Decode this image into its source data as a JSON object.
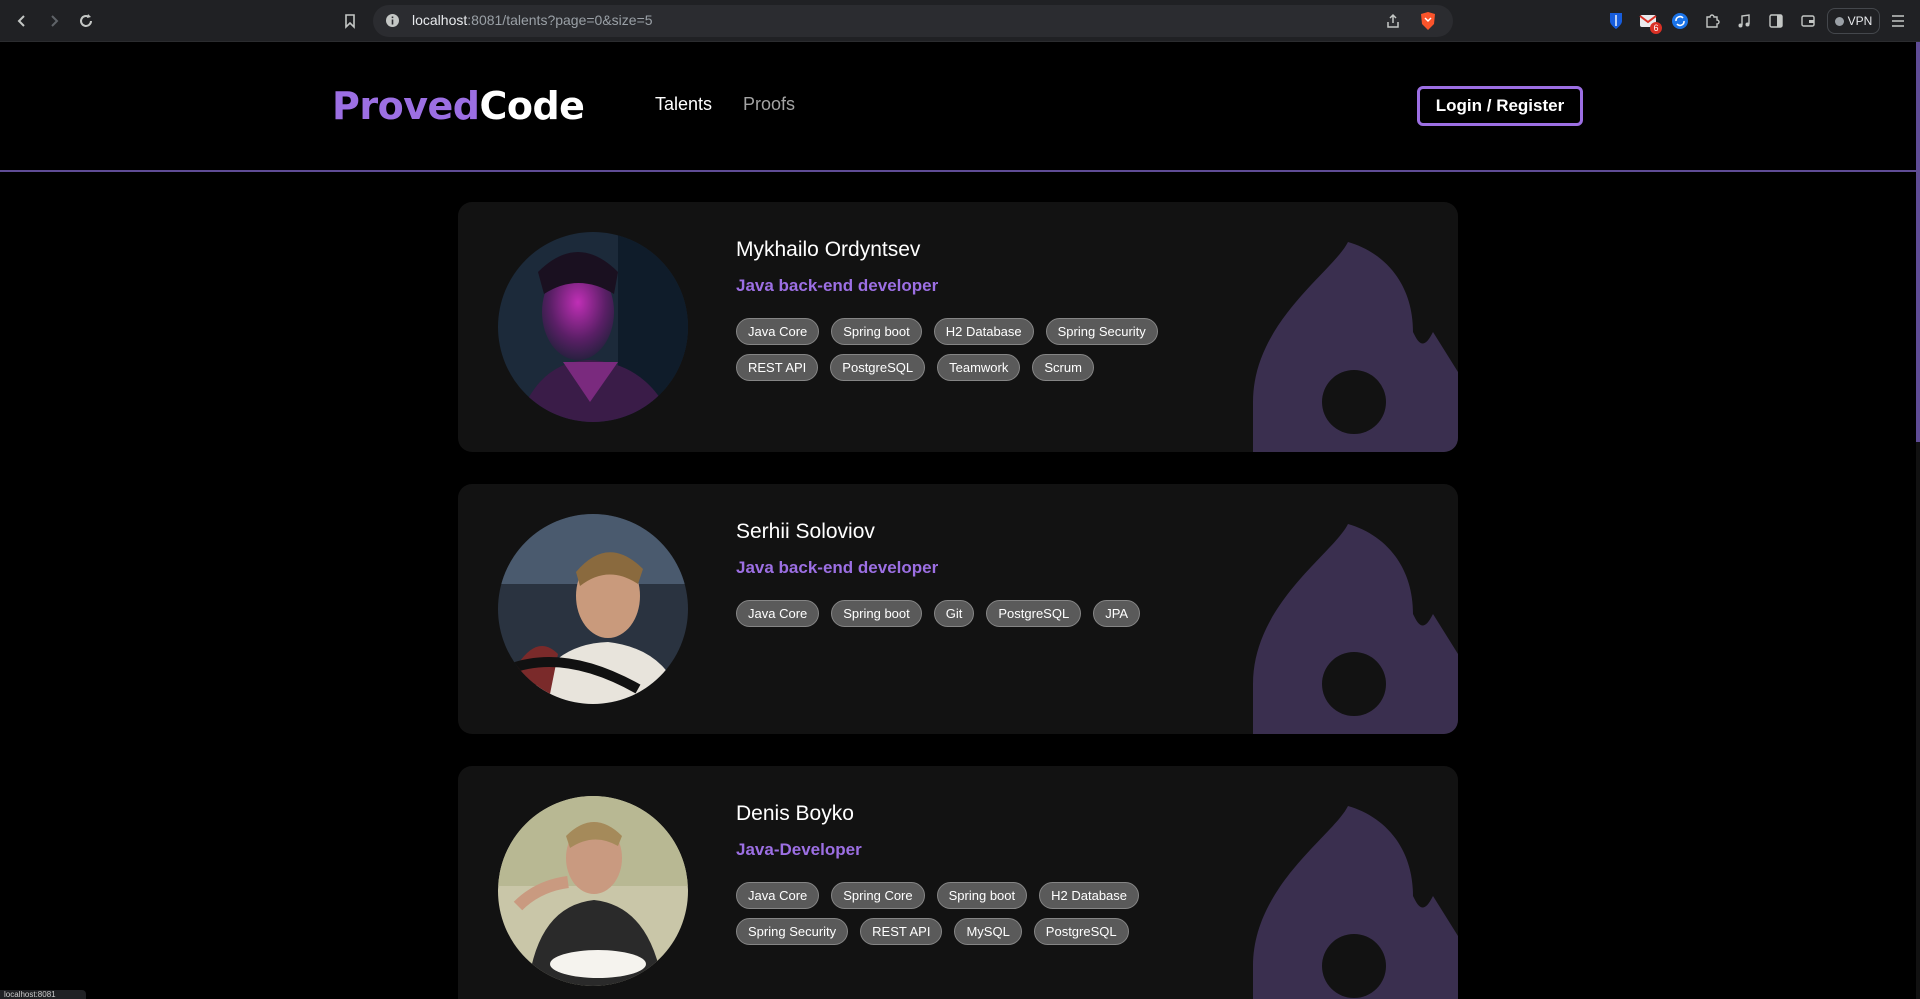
{
  "browser": {
    "url_host": "localhost",
    "url_rest": ":8081/talents?page=0&size=5",
    "extensions_badge": "6",
    "vpn_label": "VPN"
  },
  "site": {
    "logo_part1": "Proved",
    "logo_part2": "Code",
    "nav": [
      {
        "label": "Talents"
      },
      {
        "label": "Proofs"
      }
    ],
    "login_label": "Login / Register"
  },
  "talents": [
    {
      "name": "Mykhailo Ordyntsev",
      "role": "Java back-end developer",
      "skills": [
        "Java Core",
        "Spring boot",
        "H2 Database",
        "Spring Security",
        "REST API",
        "PostgreSQL",
        "Teamwork",
        "Scrum"
      ]
    },
    {
      "name": "Serhii Soloviov",
      "role": "Java back-end developer",
      "skills": [
        "Java Core",
        "Spring boot",
        "Git",
        "PostgreSQL",
        "JPA"
      ]
    },
    {
      "name": "Denis Boyko",
      "role": "Java-Developer",
      "skills": [
        "Java Core",
        "Spring Core",
        "Spring boot",
        "H2 Database",
        "Spring Security",
        "REST API",
        "MySQL",
        "PostgreSQL"
      ]
    }
  ],
  "status_bar": "localhost:8081",
  "colors": {
    "accent": "#9c6fe3",
    "card_bg": "#121212",
    "tag_bg": "#5a5a5a",
    "flame": "#3a2f4f"
  }
}
